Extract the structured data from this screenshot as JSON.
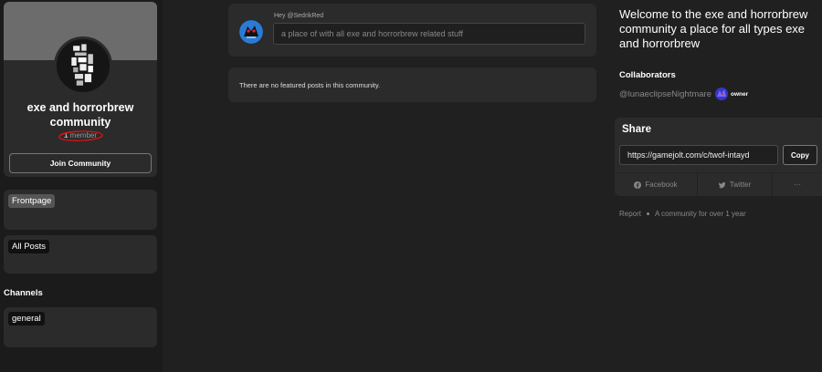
{
  "community": {
    "name": "exe and horrorbrew community",
    "member_count": "1",
    "member_label": "member",
    "join_label": "Join Community"
  },
  "nav": {
    "frontpage_label": "Frontpage",
    "all_posts_label": "All Posts",
    "channels_title": "Channels",
    "channels": [
      "general"
    ]
  },
  "composer": {
    "greeting": "Hey @SedrikRed",
    "placeholder": "a place of with all exe and horrorbrew related stuff"
  },
  "featured": {
    "empty_text": "There are no featured posts in this community."
  },
  "about": {
    "description": "Welcome to the exe and horrorbrew community a place for all types exe and horrorbrew"
  },
  "collaborators": {
    "title": "Collaborators",
    "items": [
      {
        "username": "@lunaeclipseNightmare",
        "role": "owner"
      }
    ]
  },
  "share": {
    "title": "Share",
    "url": "https://gamejolt.com/c/twof-intayd",
    "copy_label": "Copy",
    "facebook_label": "Facebook",
    "twitter_label": "Twitter",
    "more_label": "···"
  },
  "footer": {
    "report_label": "Report",
    "age_text": "A community for over 1 year"
  },
  "colors": {
    "background": "#202020",
    "card": "#2b2b2b",
    "annotation_circle": "#e01010"
  }
}
